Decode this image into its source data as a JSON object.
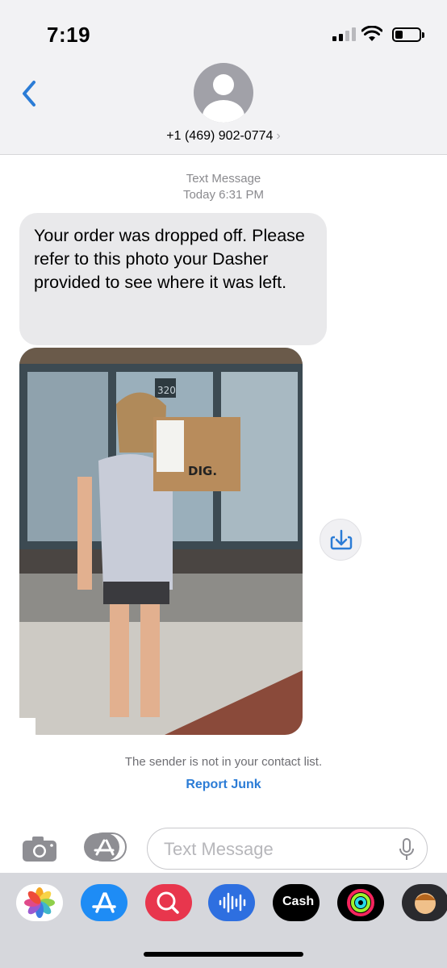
{
  "status_bar": {
    "time": "7:19"
  },
  "header": {
    "back_icon": "chevron-left-icon",
    "contact_number": "+1 (469) 902-0774",
    "contact_chevron": "›"
  },
  "conversation": {
    "meta_type": "Text Message",
    "meta_time": "Today 6:31 PM",
    "message": "Your order was dropped off. Please refer to this photo your Dasher provided to see where it was left.",
    "photo": {
      "description_icon": "photo-attachment",
      "bag_label": "DIG.",
      "building_number": "320"
    },
    "save_icon": "save-download-icon"
  },
  "notice": {
    "text": "The sender is not in your contact list.",
    "report_label": "Report Junk"
  },
  "input_bar": {
    "placeholder": "Text Message",
    "camera_icon": "camera-icon",
    "apps_icon": "app-store-icon",
    "mic_icon": "mic-icon"
  },
  "app_strip": {
    "apps": [
      {
        "name": "photos-icon"
      },
      {
        "name": "app-store-icon"
      },
      {
        "name": "search-images-icon"
      },
      {
        "name": "audio-message-icon"
      },
      {
        "name": "apple-cash-icon",
        "label": "Cash"
      },
      {
        "name": "fitness-icon"
      },
      {
        "name": "memoji-icon"
      }
    ]
  },
  "colors": {
    "accent": "#2b7cd6",
    "bubble": "#e9e9eb",
    "header_bg": "#f2f2f4",
    "strip_bg": "#d6d7dc"
  }
}
